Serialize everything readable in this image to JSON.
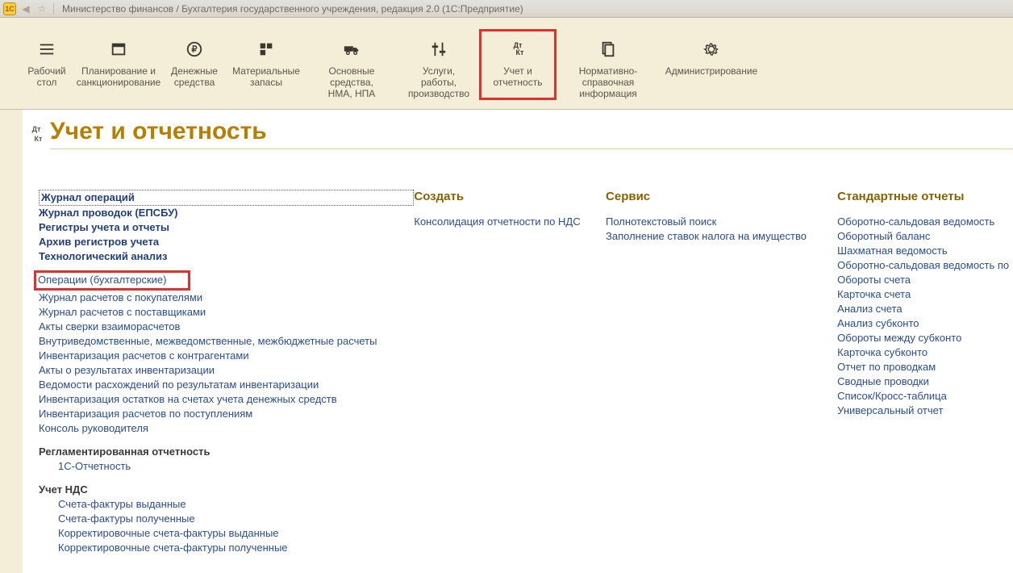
{
  "titlebar": {
    "text": "Министерство финансов / Бухгалтерия государственного учреждения, редакция 2.0  (1С:Предприятие)"
  },
  "topnav": [
    {
      "label1": "Рабочий",
      "label2": "стол"
    },
    {
      "label1": "Планирование и",
      "label2": "санкционирование"
    },
    {
      "label1": "Денежные",
      "label2": "средства"
    },
    {
      "label1": "Материальные",
      "label2": "запасы"
    },
    {
      "label1": "Основные средства,",
      "label2": "НМА, НПА"
    },
    {
      "label1": "Услуги, работы,",
      "label2": "производство"
    },
    {
      "label1": "Учет и",
      "label2": "отчетность"
    },
    {
      "label1": "Нормативно-справочная",
      "label2": "информация"
    },
    {
      "label1": "Администрирование",
      "label2": ""
    }
  ],
  "page": {
    "title": "Учет и отчетность"
  },
  "col0": {
    "main_bold": [
      "Журнал операций",
      "Журнал проводок (ЕПСБУ)",
      "Регистры учета и отчеты",
      "Архив регистров учета",
      "Технологический анализ"
    ],
    "highlight": "Операции (бухгалтерские)",
    "plain": [
      "Журнал расчетов с покупателями",
      "Журнал расчетов с поставщиками",
      "Акты сверки взаиморасчетов",
      "Внутриведомственные, межведомственные, межбюджетные расчеты",
      "Инвентаризация расчетов с контрагентами",
      "Акты о результатах инвентаризации",
      "Ведомости расхождений по результатам инвентаризации",
      "Инвентаризация остатков на счетах учета денежных средств",
      "Инвентаризация расчетов по поступлениям",
      "Консоль руководителя"
    ],
    "reglament_head": "Регламентированная отчетность",
    "reglament_item": "1С-Отчетность",
    "nds_head": "Учет НДС",
    "nds_items": [
      "Счета-фактуры выданные",
      "Счета-фактуры полученные",
      "Корректировочные счета-фактуры выданные",
      "Корректировочные счета-фактуры полученные"
    ]
  },
  "col1": {
    "head": "Создать",
    "items": [
      "Консолидация отчетности по НДС"
    ]
  },
  "col2": {
    "head": "Сервис",
    "items": [
      "Полнотекстовый поиск",
      "Заполнение ставок налога на имущество"
    ]
  },
  "col3": {
    "head": "Стандартные отчеты",
    "items": [
      "Оборотно-сальдовая ведомость",
      "Оборотный баланс",
      "Шахматная ведомость",
      "Оборотно-сальдовая ведомость по",
      "Обороты счета",
      "Карточка счета",
      "Анализ счета",
      "Анализ субконто",
      "Обороты между субконто",
      "Карточка субконто",
      "Отчет по проводкам",
      "Сводные проводки",
      "Список/Кросс-таблица",
      "Универсальный отчет"
    ]
  }
}
